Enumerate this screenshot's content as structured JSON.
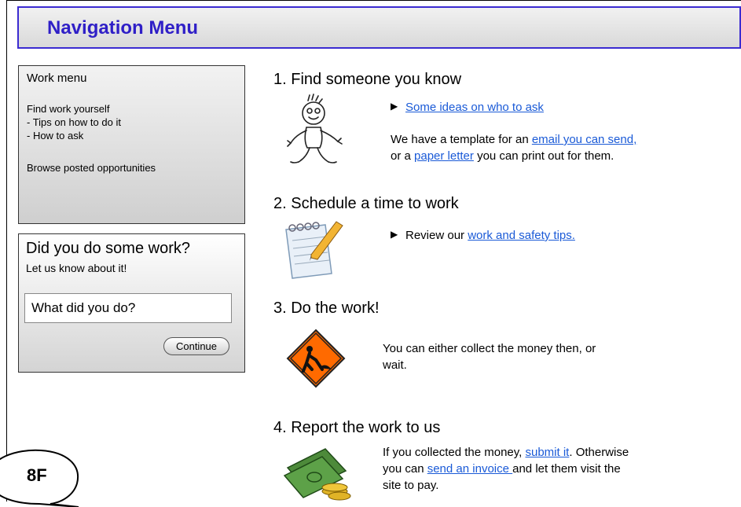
{
  "nav": {
    "title": "Navigation Menu"
  },
  "work_menu": {
    "title": "Work menu",
    "items": [
      "Find work yourself",
      "- Tips on how to do it",
      "- How to ask",
      "Browse posted opportunities"
    ]
  },
  "did_work": {
    "title": "Did you do some work?",
    "subtitle": "Let us know about it!",
    "input_placeholder": "What did you do?",
    "button_label": "Continue"
  },
  "steps": [
    {
      "title": "1. Find someone you know",
      "arrow_link": "Some ideas on who to ask",
      "text_a": "We have a template for an ",
      "link_a": "email you can send,",
      "text_b": "or a ",
      "link_b": "paper letter",
      "text_c": " you can print out for them."
    },
    {
      "title": "2. Schedule a time to work",
      "text_a": "Review our ",
      "link_a": "work and safety tips."
    },
    {
      "title": "3. Do the work!",
      "line1": "You can either collect the money then, or",
      "line2": "wait."
    },
    {
      "title": "4. Report the work to us",
      "text_a": "If you collected the money, ",
      "link_a": "submit it",
      "text_b": ". Otherwise",
      "text_c": "you can ",
      "link_b": "send an invoice ",
      "text_d": "and let them visit the",
      "line3": "site to pay."
    }
  ],
  "badge": {
    "label": "8F"
  },
  "colors": {
    "nav_title": "#2f1fc7",
    "nav_border": "#3b2bd1",
    "link": "#1a5ad7",
    "sign": "#ff6a00"
  }
}
